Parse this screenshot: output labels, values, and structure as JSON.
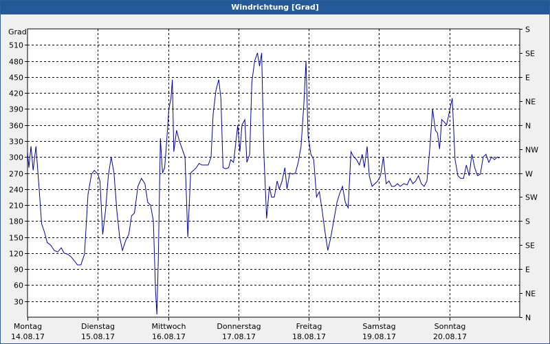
{
  "window": {
    "title": "Windrichtung [Grad]"
  },
  "chart_data": {
    "type": "line",
    "title": "Windrichtung [Grad]",
    "ylabel": "Grad",
    "ylim": [
      0,
      540
    ],
    "xlim": [
      0,
      7
    ],
    "grid": true,
    "yticks": [
      30,
      60,
      90,
      120,
      150,
      180,
      210,
      240,
      270,
      300,
      330,
      360,
      390,
      420,
      450,
      480,
      510
    ],
    "y2ticks": [
      {
        "v": 0,
        "label": "N"
      },
      {
        "v": 45,
        "label": "NE"
      },
      {
        "v": 90,
        "label": "E"
      },
      {
        "v": 135,
        "label": "SE"
      },
      {
        "v": 180,
        "label": "S"
      },
      {
        "v": 225,
        "label": "SW"
      },
      {
        "v": 270,
        "label": "W"
      },
      {
        "v": 315,
        "label": "NW"
      },
      {
        "v": 360,
        "label": "N"
      },
      {
        "v": 405,
        "label": "NE"
      },
      {
        "v": 450,
        "label": "E"
      },
      {
        "v": 495,
        "label": "SE"
      },
      {
        "v": 540,
        "label": "S"
      }
    ],
    "xticks": [
      {
        "pos": 0,
        "day": "Montag",
        "date": "14.08.17"
      },
      {
        "pos": 1,
        "day": "Dienstag",
        "date": "15.08.17"
      },
      {
        "pos": 2,
        "day": "Mittwoch",
        "date": "16.08.17"
      },
      {
        "pos": 3,
        "day": "Donnerstag",
        "date": "17.08.17"
      },
      {
        "pos": 4,
        "day": "Freitag",
        "date": "18.08.17"
      },
      {
        "pos": 5,
        "day": "Samstag",
        "date": "19.08.17"
      },
      {
        "pos": 6,
        "day": "Sonntag",
        "date": "20.08.17"
      }
    ],
    "series": [
      {
        "color": "#0000a0",
        "points": [
          [
            0.0,
            310
          ],
          [
            0.02,
            280
          ],
          [
            0.05,
            320
          ],
          [
            0.08,
            275
          ],
          [
            0.12,
            320
          ],
          [
            0.16,
            250
          ],
          [
            0.2,
            175
          ],
          [
            0.24,
            160
          ],
          [
            0.28,
            140
          ],
          [
            0.33,
            135
          ],
          [
            0.38,
            125
          ],
          [
            0.43,
            122
          ],
          [
            0.48,
            130
          ],
          [
            0.52,
            120
          ],
          [
            0.57,
            118
          ],
          [
            0.62,
            113
          ],
          [
            0.67,
            105
          ],
          [
            0.71,
            98
          ],
          [
            0.76,
            98
          ],
          [
            0.81,
            118
          ],
          [
            0.86,
            230
          ],
          [
            0.91,
            268
          ],
          [
            0.95,
            275
          ],
          [
            1.0,
            268
          ],
          [
            1.03,
            255
          ],
          [
            1.07,
            155
          ],
          [
            1.11,
            200
          ],
          [
            1.15,
            265
          ],
          [
            1.19,
            300
          ],
          [
            1.23,
            270
          ],
          [
            1.27,
            200
          ],
          [
            1.31,
            150
          ],
          [
            1.35,
            125
          ],
          [
            1.4,
            145
          ],
          [
            1.44,
            155
          ],
          [
            1.48,
            190
          ],
          [
            1.52,
            195
          ],
          [
            1.57,
            245
          ],
          [
            1.62,
            260
          ],
          [
            1.67,
            250
          ],
          [
            1.71,
            215
          ],
          [
            1.75,
            210
          ],
          [
            1.79,
            180
          ],
          [
            1.82,
            50
          ],
          [
            1.84,
            5
          ],
          [
            1.86,
            110
          ],
          [
            1.89,
            335
          ],
          [
            1.92,
            270
          ],
          [
            1.95,
            280
          ],
          [
            1.98,
            330
          ],
          [
            2.01,
            390
          ],
          [
            2.04,
            410
          ],
          [
            2.06,
            445
          ],
          [
            2.08,
            310
          ],
          [
            2.12,
            350
          ],
          [
            2.16,
            330
          ],
          [
            2.2,
            315
          ],
          [
            2.24,
            300
          ],
          [
            2.28,
            150
          ],
          [
            2.32,
            270
          ],
          [
            2.36,
            275
          ],
          [
            2.4,
            280
          ],
          [
            2.44,
            288
          ],
          [
            2.48,
            285
          ],
          [
            2.53,
            285
          ],
          [
            2.57,
            285
          ],
          [
            2.61,
            300
          ],
          [
            2.64,
            380
          ],
          [
            2.68,
            425
          ],
          [
            2.72,
            445
          ],
          [
            2.75,
            410
          ],
          [
            2.78,
            280
          ],
          [
            2.82,
            278
          ],
          [
            2.86,
            280
          ],
          [
            2.89,
            295
          ],
          [
            2.93,
            290
          ],
          [
            2.96,
            325
          ],
          [
            2.99,
            360
          ],
          [
            3.02,
            310
          ],
          [
            3.05,
            360
          ],
          [
            3.09,
            370
          ],
          [
            3.12,
            290
          ],
          [
            3.16,
            305
          ],
          [
            3.19,
            440
          ],
          [
            3.23,
            480
          ],
          [
            3.27,
            495
          ],
          [
            3.3,
            470
          ],
          [
            3.33,
            495
          ],
          [
            3.36,
            310
          ],
          [
            3.4,
            185
          ],
          [
            3.44,
            245
          ],
          [
            3.47,
            225
          ],
          [
            3.51,
            225
          ],
          [
            3.55,
            255
          ],
          [
            3.58,
            240
          ],
          [
            3.62,
            255
          ],
          [
            3.66,
            280
          ],
          [
            3.69,
            240
          ],
          [
            3.73,
            270
          ],
          [
            3.77,
            268
          ],
          [
            3.81,
            270
          ],
          [
            3.85,
            290
          ],
          [
            3.89,
            320
          ],
          [
            3.93,
            400
          ],
          [
            3.96,
            480
          ],
          [
            3.99,
            340
          ],
          [
            4.03,
            305
          ],
          [
            4.07,
            295
          ],
          [
            4.11,
            225
          ],
          [
            4.15,
            235
          ],
          [
            4.19,
            200
          ],
          [
            4.23,
            160
          ],
          [
            4.27,
            125
          ],
          [
            4.31,
            148
          ],
          [
            4.36,
            185
          ],
          [
            4.4,
            215
          ],
          [
            4.44,
            232
          ],
          [
            4.48,
            245
          ],
          [
            4.52,
            215
          ],
          [
            4.56,
            205
          ],
          [
            4.6,
            310
          ],
          [
            4.64,
            300
          ],
          [
            4.68,
            295
          ],
          [
            4.72,
            285
          ],
          [
            4.76,
            305
          ],
          [
            4.79,
            280
          ],
          [
            4.83,
            320
          ],
          [
            4.86,
            265
          ],
          [
            4.9,
            245
          ],
          [
            4.94,
            250
          ],
          [
            4.98,
            255
          ],
          [
            5.02,
            265
          ],
          [
            5.06,
            300
          ],
          [
            5.1,
            250
          ],
          [
            5.14,
            255
          ],
          [
            5.18,
            245
          ],
          [
            5.22,
            245
          ],
          [
            5.26,
            250
          ],
          [
            5.3,
            245
          ],
          [
            5.35,
            250
          ],
          [
            5.4,
            248
          ],
          [
            5.44,
            260
          ],
          [
            5.48,
            250
          ],
          [
            5.52,
            255
          ],
          [
            5.56,
            265
          ],
          [
            5.6,
            250
          ],
          [
            5.64,
            245
          ],
          [
            5.68,
            255
          ],
          [
            5.72,
            315
          ],
          [
            5.76,
            390
          ],
          [
            5.8,
            350
          ],
          [
            5.83,
            345
          ],
          [
            5.86,
            315
          ],
          [
            5.89,
            370
          ],
          [
            5.93,
            365
          ],
          [
            5.96,
            360
          ],
          [
            6.0,
            385
          ],
          [
            6.04,
            410
          ],
          [
            6.08,
            295
          ],
          [
            6.12,
            265
          ],
          [
            6.16,
            260
          ],
          [
            6.2,
            260
          ],
          [
            6.24,
            285
          ],
          [
            6.28,
            265
          ],
          [
            6.32,
            305
          ],
          [
            6.36,
            280
          ],
          [
            6.4,
            265
          ],
          [
            6.44,
            268
          ],
          [
            6.48,
            300
          ],
          [
            6.52,
            305
          ],
          [
            6.56,
            290
          ],
          [
            6.6,
            300
          ],
          [
            6.64,
            295
          ],
          [
            6.68,
            300
          ],
          [
            6.71,
            298
          ]
        ]
      }
    ]
  }
}
